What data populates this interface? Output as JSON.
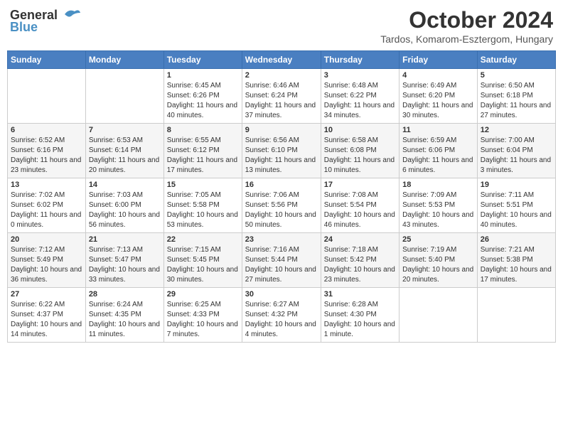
{
  "header": {
    "logo_line1": "General",
    "logo_line2": "Blue",
    "month_title": "October 2024",
    "location": "Tardos, Komarom-Esztergom, Hungary"
  },
  "calendar": {
    "days_of_week": [
      "Sunday",
      "Monday",
      "Tuesday",
      "Wednesday",
      "Thursday",
      "Friday",
      "Saturday"
    ],
    "weeks": [
      [
        {
          "num": "",
          "info": ""
        },
        {
          "num": "",
          "info": ""
        },
        {
          "num": "1",
          "info": "Sunrise: 6:45 AM\nSunset: 6:26 PM\nDaylight: 11 hours and 40 minutes."
        },
        {
          "num": "2",
          "info": "Sunrise: 6:46 AM\nSunset: 6:24 PM\nDaylight: 11 hours and 37 minutes."
        },
        {
          "num": "3",
          "info": "Sunrise: 6:48 AM\nSunset: 6:22 PM\nDaylight: 11 hours and 34 minutes."
        },
        {
          "num": "4",
          "info": "Sunrise: 6:49 AM\nSunset: 6:20 PM\nDaylight: 11 hours and 30 minutes."
        },
        {
          "num": "5",
          "info": "Sunrise: 6:50 AM\nSunset: 6:18 PM\nDaylight: 11 hours and 27 minutes."
        }
      ],
      [
        {
          "num": "6",
          "info": "Sunrise: 6:52 AM\nSunset: 6:16 PM\nDaylight: 11 hours and 23 minutes."
        },
        {
          "num": "7",
          "info": "Sunrise: 6:53 AM\nSunset: 6:14 PM\nDaylight: 11 hours and 20 minutes."
        },
        {
          "num": "8",
          "info": "Sunrise: 6:55 AM\nSunset: 6:12 PM\nDaylight: 11 hours and 17 minutes."
        },
        {
          "num": "9",
          "info": "Sunrise: 6:56 AM\nSunset: 6:10 PM\nDaylight: 11 hours and 13 minutes."
        },
        {
          "num": "10",
          "info": "Sunrise: 6:58 AM\nSunset: 6:08 PM\nDaylight: 11 hours and 10 minutes."
        },
        {
          "num": "11",
          "info": "Sunrise: 6:59 AM\nSunset: 6:06 PM\nDaylight: 11 hours and 6 minutes."
        },
        {
          "num": "12",
          "info": "Sunrise: 7:00 AM\nSunset: 6:04 PM\nDaylight: 11 hours and 3 minutes."
        }
      ],
      [
        {
          "num": "13",
          "info": "Sunrise: 7:02 AM\nSunset: 6:02 PM\nDaylight: 11 hours and 0 minutes."
        },
        {
          "num": "14",
          "info": "Sunrise: 7:03 AM\nSunset: 6:00 PM\nDaylight: 10 hours and 56 minutes."
        },
        {
          "num": "15",
          "info": "Sunrise: 7:05 AM\nSunset: 5:58 PM\nDaylight: 10 hours and 53 minutes."
        },
        {
          "num": "16",
          "info": "Sunrise: 7:06 AM\nSunset: 5:56 PM\nDaylight: 10 hours and 50 minutes."
        },
        {
          "num": "17",
          "info": "Sunrise: 7:08 AM\nSunset: 5:54 PM\nDaylight: 10 hours and 46 minutes."
        },
        {
          "num": "18",
          "info": "Sunrise: 7:09 AM\nSunset: 5:53 PM\nDaylight: 10 hours and 43 minutes."
        },
        {
          "num": "19",
          "info": "Sunrise: 7:11 AM\nSunset: 5:51 PM\nDaylight: 10 hours and 40 minutes."
        }
      ],
      [
        {
          "num": "20",
          "info": "Sunrise: 7:12 AM\nSunset: 5:49 PM\nDaylight: 10 hours and 36 minutes."
        },
        {
          "num": "21",
          "info": "Sunrise: 7:13 AM\nSunset: 5:47 PM\nDaylight: 10 hours and 33 minutes."
        },
        {
          "num": "22",
          "info": "Sunrise: 7:15 AM\nSunset: 5:45 PM\nDaylight: 10 hours and 30 minutes."
        },
        {
          "num": "23",
          "info": "Sunrise: 7:16 AM\nSunset: 5:44 PM\nDaylight: 10 hours and 27 minutes."
        },
        {
          "num": "24",
          "info": "Sunrise: 7:18 AM\nSunset: 5:42 PM\nDaylight: 10 hours and 23 minutes."
        },
        {
          "num": "25",
          "info": "Sunrise: 7:19 AM\nSunset: 5:40 PM\nDaylight: 10 hours and 20 minutes."
        },
        {
          "num": "26",
          "info": "Sunrise: 7:21 AM\nSunset: 5:38 PM\nDaylight: 10 hours and 17 minutes."
        }
      ],
      [
        {
          "num": "27",
          "info": "Sunrise: 6:22 AM\nSunset: 4:37 PM\nDaylight: 10 hours and 14 minutes."
        },
        {
          "num": "28",
          "info": "Sunrise: 6:24 AM\nSunset: 4:35 PM\nDaylight: 10 hours and 11 minutes."
        },
        {
          "num": "29",
          "info": "Sunrise: 6:25 AM\nSunset: 4:33 PM\nDaylight: 10 hours and 7 minutes."
        },
        {
          "num": "30",
          "info": "Sunrise: 6:27 AM\nSunset: 4:32 PM\nDaylight: 10 hours and 4 minutes."
        },
        {
          "num": "31",
          "info": "Sunrise: 6:28 AM\nSunset: 4:30 PM\nDaylight: 10 hours and 1 minute."
        },
        {
          "num": "",
          "info": ""
        },
        {
          "num": "",
          "info": ""
        }
      ]
    ]
  }
}
